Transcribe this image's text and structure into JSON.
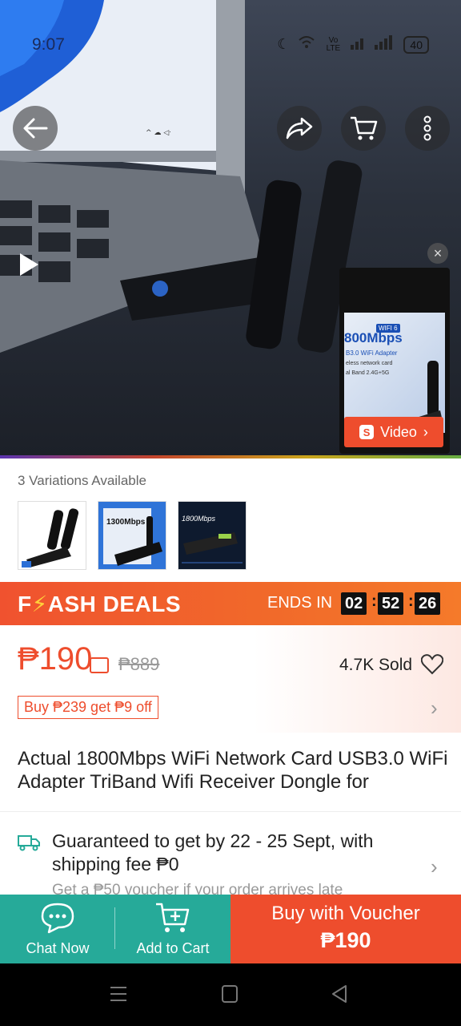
{
  "status_bar": {
    "time": "9:07",
    "battery": "40",
    "network_label": "Vo LTE"
  },
  "hero": {
    "mini_video": {
      "speed_text": "800Mbps",
      "badge": "WIFI 6",
      "line1": "B3.0 WiFi Adapter",
      "line2": "eless network card",
      "line3": "al Band  2.4G+5G",
      "button_label": "Video",
      "button_icon": "S"
    },
    "close_symbol": "×"
  },
  "variations": {
    "label": "3 Variations Available",
    "thumb2_text": "1300Mbps",
    "thumb3_text": "1800Mbps"
  },
  "flash": {
    "title_prefix": "F",
    "title_rest": "ASH DEALS",
    "ends_label": "ENDS IN",
    "hours": "02",
    "minutes": "52",
    "seconds": "26"
  },
  "price": {
    "current": "₱190",
    "original": "₱889",
    "sold": "4.7K Sold",
    "promo": "Buy ₱239 get ₱9 off"
  },
  "product": {
    "title": "Actual 1800Mbps WiFi Network Card USB3.0 WiFi Adapter TriBand Wifi Receiver Dongle for"
  },
  "shipping": {
    "text": "Guaranteed to get by 22 - 25 Sept, with shipping fee ₱0",
    "sub": "Get a ₱50 voucher if your order arrives late"
  },
  "bottom_bar": {
    "chat_label": "Chat Now",
    "cart_label": "Add to Cart",
    "voucher_label": "Buy with Voucher",
    "voucher_price": "₱190"
  },
  "colors": {
    "brand": "#ee4d2d",
    "teal": "#26aa99"
  }
}
